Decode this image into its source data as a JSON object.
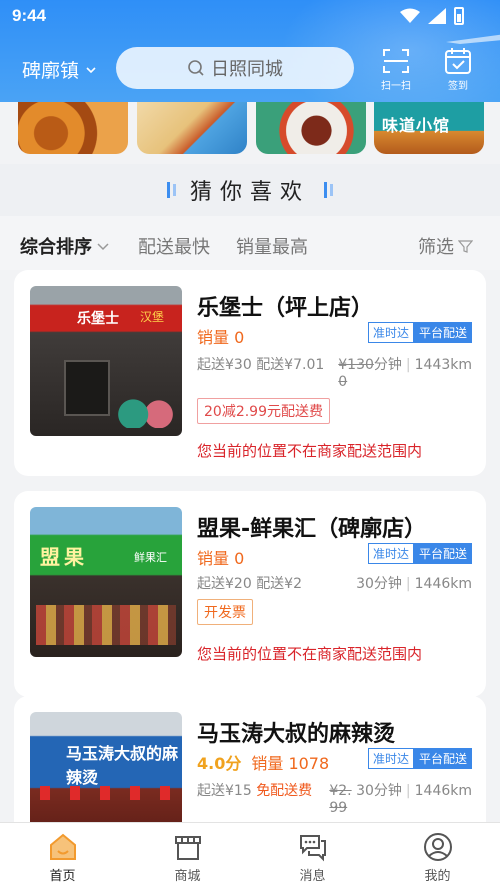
{
  "status_bar": {
    "time": "9:44"
  },
  "header": {
    "location": "碑廓镇",
    "search_placeholder": "日照同城",
    "scan_label": "扫一扫",
    "checkin_label": "签到"
  },
  "banners": [
    {
      "text": ""
    },
    {
      "text": ""
    },
    {
      "text": ""
    },
    {
      "text": "味道小馆"
    }
  ],
  "section": {
    "title": "猜你喜欢"
  },
  "sort": {
    "items": [
      {
        "label": "综合排序",
        "active": true
      },
      {
        "label": "配送最快",
        "active": false
      },
      {
        "label": "销量最高",
        "active": false
      }
    ],
    "filter_label": "筛选"
  },
  "stores": [
    {
      "name": "乐堡士（坪上店）",
      "sales": "销量 0",
      "tag_ontime": "准时达",
      "tag_platform": "平台配送",
      "min_order": "起送¥30",
      "delivery_fee": "配送¥7.01",
      "original_fee": "¥130",
      "original_fee_tail": "0",
      "time": "分钟",
      "distance": "1443km",
      "promo": "20减2.99元配送费",
      "warning": "您当前的位置不在商家配送范围内",
      "thumb_sign": "乐堡士",
      "thumb_sign2": "汉堡"
    },
    {
      "name": "盟果-鲜果汇（碑廓店）",
      "sales": "销量 0",
      "tag_ontime": "准时达",
      "tag_platform": "平台配送",
      "min_order": "起送¥20",
      "delivery_fee": "配送¥2",
      "time": "30分钟",
      "distance": "1446km",
      "invoice": "开发票",
      "warning": "您当前的位置不在商家配送范围内",
      "thumb_sign": "盟果",
      "thumb_sign2": "鲜果汇"
    },
    {
      "name": "马玉涛大叔的麻辣烫",
      "rating": "4.0分",
      "sales": "销量 1078",
      "tag_ontime": "准时达",
      "tag_platform": "平台配送",
      "min_order": "起送¥15",
      "free_delivery": "免配送费",
      "original_fee": "¥2.",
      "original_fee_tail": "99",
      "time": "30分钟",
      "distance": "1446km",
      "thumb_sign": "马玉涛大叔的麻辣烫"
    }
  ],
  "tabbar": [
    {
      "label": "首页",
      "icon": "home-icon",
      "active": true
    },
    {
      "label": "商城",
      "icon": "mall-icon",
      "active": false
    },
    {
      "label": "消息",
      "icon": "message-icon",
      "active": false
    },
    {
      "label": "我的",
      "icon": "profile-icon",
      "active": false
    }
  ],
  "colors": {
    "primary": "#2f8ff7",
    "accent_orange": "#f0691e",
    "warning_red": "#d9242a",
    "tab_active": "#f29a2e"
  }
}
